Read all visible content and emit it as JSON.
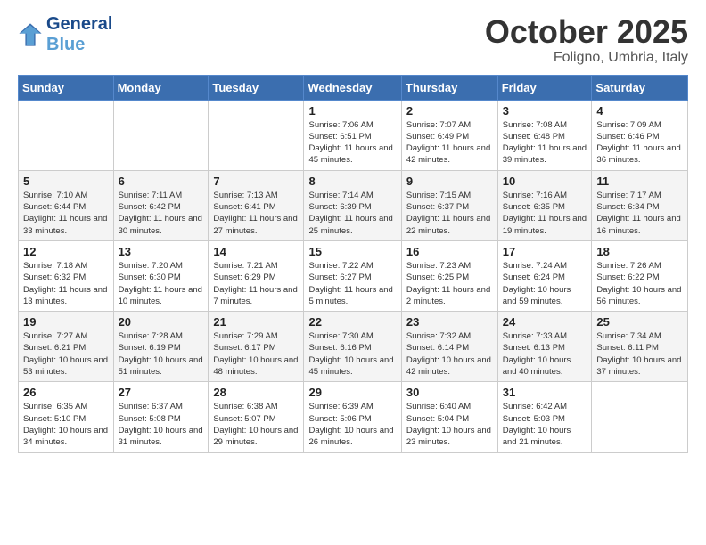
{
  "header": {
    "logo_line1": "General",
    "logo_line2": "Blue",
    "month_title": "October 2025",
    "subtitle": "Foligno, Umbria, Italy"
  },
  "weekdays": [
    "Sunday",
    "Monday",
    "Tuesday",
    "Wednesday",
    "Thursday",
    "Friday",
    "Saturday"
  ],
  "weeks": [
    [
      {
        "day": "",
        "info": ""
      },
      {
        "day": "",
        "info": ""
      },
      {
        "day": "",
        "info": ""
      },
      {
        "day": "1",
        "info": "Sunrise: 7:06 AM\nSunset: 6:51 PM\nDaylight: 11 hours and 45 minutes."
      },
      {
        "day": "2",
        "info": "Sunrise: 7:07 AM\nSunset: 6:49 PM\nDaylight: 11 hours and 42 minutes."
      },
      {
        "day": "3",
        "info": "Sunrise: 7:08 AM\nSunset: 6:48 PM\nDaylight: 11 hours and 39 minutes."
      },
      {
        "day": "4",
        "info": "Sunrise: 7:09 AM\nSunset: 6:46 PM\nDaylight: 11 hours and 36 minutes."
      }
    ],
    [
      {
        "day": "5",
        "info": "Sunrise: 7:10 AM\nSunset: 6:44 PM\nDaylight: 11 hours and 33 minutes."
      },
      {
        "day": "6",
        "info": "Sunrise: 7:11 AM\nSunset: 6:42 PM\nDaylight: 11 hours and 30 minutes."
      },
      {
        "day": "7",
        "info": "Sunrise: 7:13 AM\nSunset: 6:41 PM\nDaylight: 11 hours and 27 minutes."
      },
      {
        "day": "8",
        "info": "Sunrise: 7:14 AM\nSunset: 6:39 PM\nDaylight: 11 hours and 25 minutes."
      },
      {
        "day": "9",
        "info": "Sunrise: 7:15 AM\nSunset: 6:37 PM\nDaylight: 11 hours and 22 minutes."
      },
      {
        "day": "10",
        "info": "Sunrise: 7:16 AM\nSunset: 6:35 PM\nDaylight: 11 hours and 19 minutes."
      },
      {
        "day": "11",
        "info": "Sunrise: 7:17 AM\nSunset: 6:34 PM\nDaylight: 11 hours and 16 minutes."
      }
    ],
    [
      {
        "day": "12",
        "info": "Sunrise: 7:18 AM\nSunset: 6:32 PM\nDaylight: 11 hours and 13 minutes."
      },
      {
        "day": "13",
        "info": "Sunrise: 7:20 AM\nSunset: 6:30 PM\nDaylight: 11 hours and 10 minutes."
      },
      {
        "day": "14",
        "info": "Sunrise: 7:21 AM\nSunset: 6:29 PM\nDaylight: 11 hours and 7 minutes."
      },
      {
        "day": "15",
        "info": "Sunrise: 7:22 AM\nSunset: 6:27 PM\nDaylight: 11 hours and 5 minutes."
      },
      {
        "day": "16",
        "info": "Sunrise: 7:23 AM\nSunset: 6:25 PM\nDaylight: 11 hours and 2 minutes."
      },
      {
        "day": "17",
        "info": "Sunrise: 7:24 AM\nSunset: 6:24 PM\nDaylight: 10 hours and 59 minutes."
      },
      {
        "day": "18",
        "info": "Sunrise: 7:26 AM\nSunset: 6:22 PM\nDaylight: 10 hours and 56 minutes."
      }
    ],
    [
      {
        "day": "19",
        "info": "Sunrise: 7:27 AM\nSunset: 6:21 PM\nDaylight: 10 hours and 53 minutes."
      },
      {
        "day": "20",
        "info": "Sunrise: 7:28 AM\nSunset: 6:19 PM\nDaylight: 10 hours and 51 minutes."
      },
      {
        "day": "21",
        "info": "Sunrise: 7:29 AM\nSunset: 6:17 PM\nDaylight: 10 hours and 48 minutes."
      },
      {
        "day": "22",
        "info": "Sunrise: 7:30 AM\nSunset: 6:16 PM\nDaylight: 10 hours and 45 minutes."
      },
      {
        "day": "23",
        "info": "Sunrise: 7:32 AM\nSunset: 6:14 PM\nDaylight: 10 hours and 42 minutes."
      },
      {
        "day": "24",
        "info": "Sunrise: 7:33 AM\nSunset: 6:13 PM\nDaylight: 10 hours and 40 minutes."
      },
      {
        "day": "25",
        "info": "Sunrise: 7:34 AM\nSunset: 6:11 PM\nDaylight: 10 hours and 37 minutes."
      }
    ],
    [
      {
        "day": "26",
        "info": "Sunrise: 6:35 AM\nSunset: 5:10 PM\nDaylight: 10 hours and 34 minutes."
      },
      {
        "day": "27",
        "info": "Sunrise: 6:37 AM\nSunset: 5:08 PM\nDaylight: 10 hours and 31 minutes."
      },
      {
        "day": "28",
        "info": "Sunrise: 6:38 AM\nSunset: 5:07 PM\nDaylight: 10 hours and 29 minutes."
      },
      {
        "day": "29",
        "info": "Sunrise: 6:39 AM\nSunset: 5:06 PM\nDaylight: 10 hours and 26 minutes."
      },
      {
        "day": "30",
        "info": "Sunrise: 6:40 AM\nSunset: 5:04 PM\nDaylight: 10 hours and 23 minutes."
      },
      {
        "day": "31",
        "info": "Sunrise: 6:42 AM\nSunset: 5:03 PM\nDaylight: 10 hours and 21 minutes."
      },
      {
        "day": "",
        "info": ""
      }
    ]
  ]
}
